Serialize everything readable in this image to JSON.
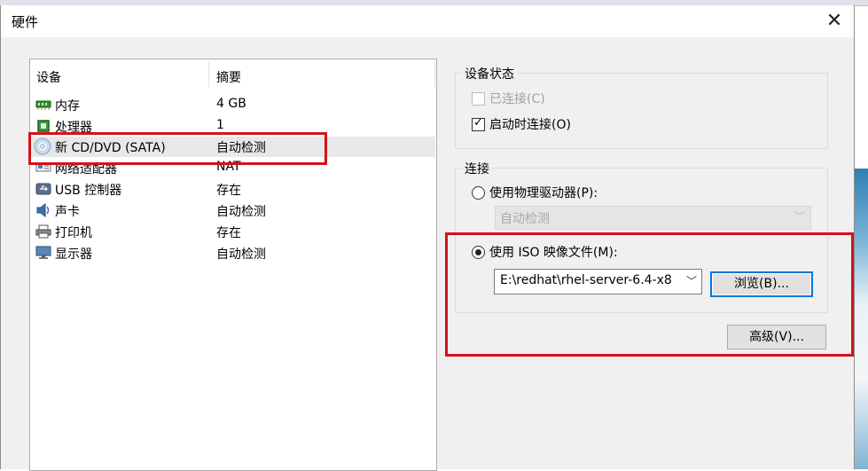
{
  "window": {
    "title": "硬件",
    "close_label": "✕",
    "left_edge_mark": "ẟ"
  },
  "device_list": {
    "columns": [
      "设备",
      "摘要"
    ],
    "rows": [
      {
        "name": "内存",
        "summary": "4 GB",
        "icon": "memory-icon"
      },
      {
        "name": "处理器",
        "summary": "1",
        "icon": "processor-icon"
      },
      {
        "name": "新 CD/DVD (SATA)",
        "summary": "自动检测",
        "icon": "cd-dvd-icon",
        "selected": true
      },
      {
        "name": "网络适配器",
        "summary": "NAT",
        "icon": "network-adapter-icon"
      },
      {
        "name": "USB 控制器",
        "summary": "存在",
        "icon": "usb-icon"
      },
      {
        "name": "声卡",
        "summary": "自动检测",
        "icon": "sound-card-icon"
      },
      {
        "name": "打印机",
        "summary": "存在",
        "icon": "printer-icon"
      },
      {
        "name": "显示器",
        "summary": "自动检测",
        "icon": "display-icon"
      }
    ]
  },
  "device_status": {
    "label": "设备状态",
    "connected_label": "已连接(C)",
    "connected_checked": false,
    "connected_disabled": true,
    "connect_at_power_on_label": "启动时连接(O)",
    "connect_at_power_on_checked": true
  },
  "connection": {
    "label": "连接",
    "physical_drive_label": "使用物理驱动器(P):",
    "physical_drive_value": "自动检测",
    "iso_label": "使用 ISO 映像文件(M):",
    "iso_selected": true,
    "iso_path": "E:\\redhat\\rhel-server-6.4-x8",
    "browse_label": "浏览(B)...",
    "advanced_label": "高级(V)..."
  },
  "colors": {
    "highlight_red": "#d4121b",
    "focus_blue": "#0078d7"
  }
}
